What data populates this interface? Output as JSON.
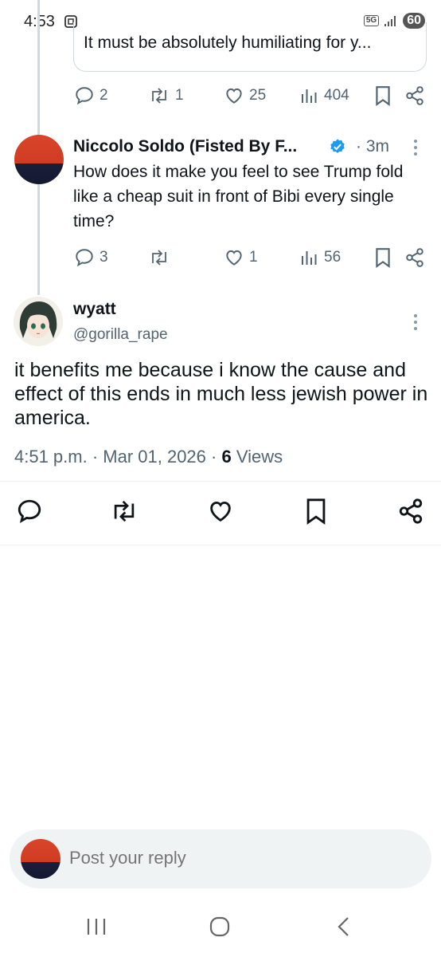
{
  "status_bar": {
    "time": "4:53",
    "network": "5G",
    "battery": "60"
  },
  "quoted_reply": {
    "text": "It must be absolutely humiliating for y...",
    "replies": "2",
    "retweets": "1",
    "likes": "25",
    "views": "404"
  },
  "reply": {
    "author": "Niccolo Soldo (Fisted By F...",
    "time": "· 3m",
    "text": "How does it make you feel to see Trump fold like a cheap suit in front of Bibi every single time?",
    "replies": "3",
    "retweets": "",
    "likes": "1",
    "views": "56"
  },
  "main_tweet": {
    "author": "wyatt",
    "handle": "@gorilla_rape",
    "text": "it benefits me because i know the cause and effect of this ends in much less jewish power in america.",
    "timestamp": "4:51 p.m. · Mar 01, 2026 ·",
    "views_count": "6",
    "views_label": "Views"
  },
  "composer": {
    "placeholder": "Post your reply"
  },
  "colors": {
    "text": "#0f1419",
    "muted": "#536471",
    "verified": "#1d9bf0",
    "thread_line": "#cfd9de"
  }
}
